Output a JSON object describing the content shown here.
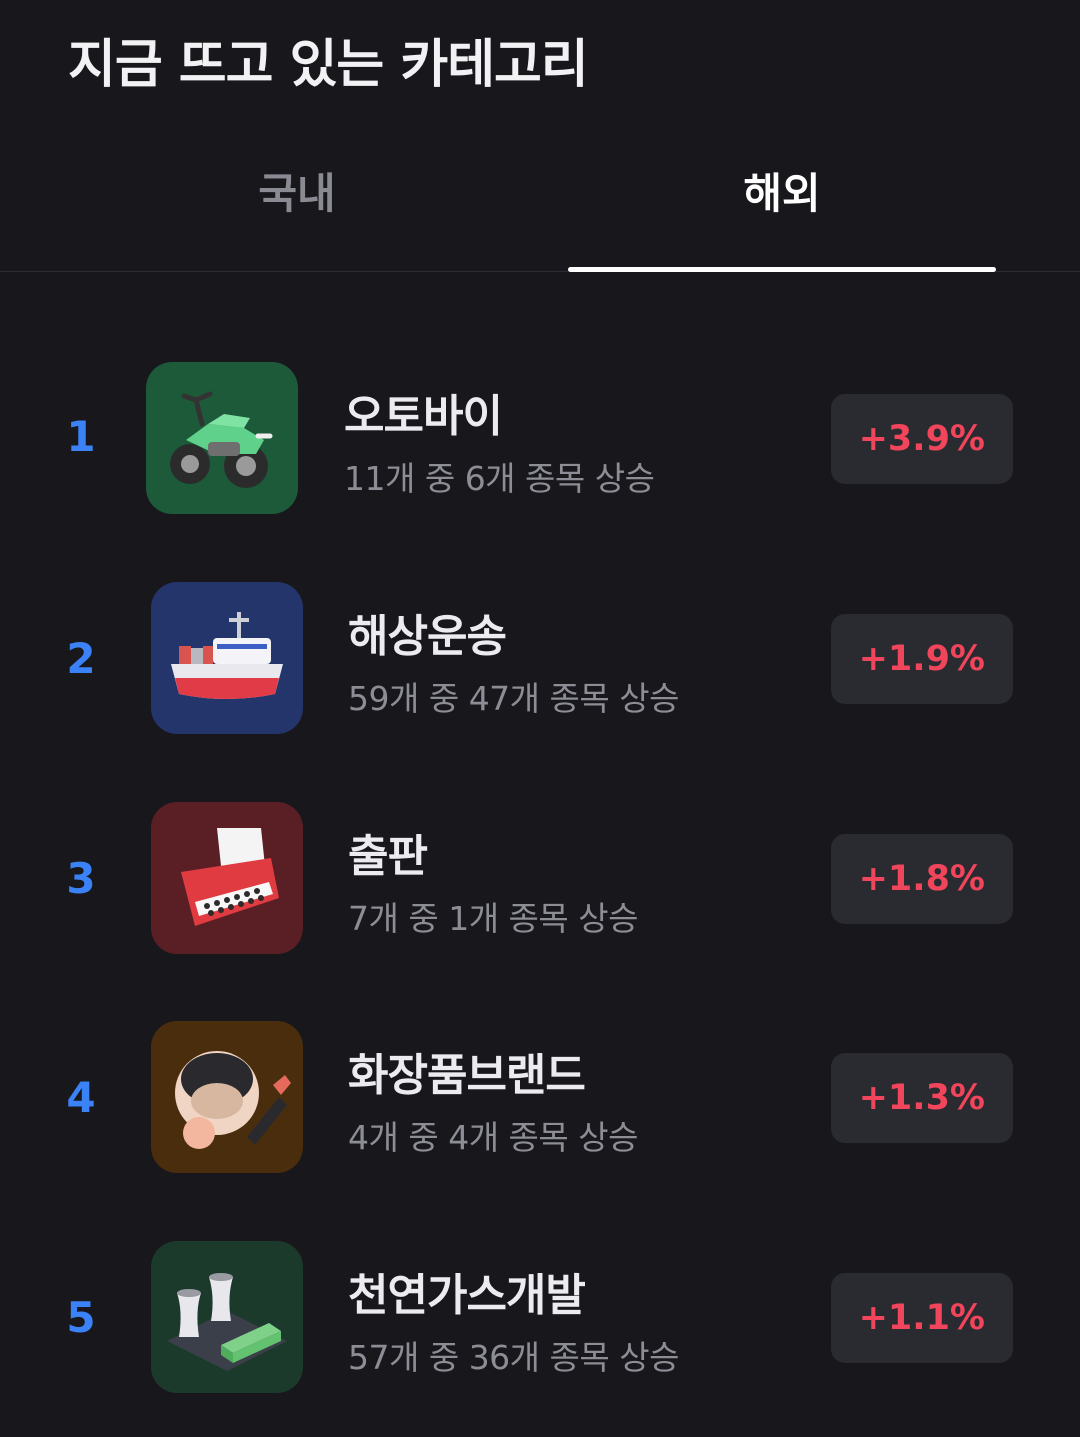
{
  "header": {
    "title": "지금 뜨고 있는 카테고리"
  },
  "tabs": [
    {
      "label": "국내",
      "active": false
    },
    {
      "label": "해외",
      "active": true
    }
  ],
  "colors": {
    "background": "#17171c",
    "rank_blue": "#3b82f6",
    "rise_red": "#f0455a",
    "badge_bg": "#2a2a31"
  },
  "categories": [
    {
      "rank": "1",
      "name": "오토바이",
      "sub": "11개 중 6개 종목 상승",
      "change": "+3.9%",
      "icon": "motorcycle-icon",
      "icon_bg": "#1d5a3a"
    },
    {
      "rank": "2",
      "name": "해상운송",
      "sub": "59개 중 47개 종목 상승",
      "change": "+1.9%",
      "icon": "ship-icon",
      "icon_bg": "#23356a"
    },
    {
      "rank": "3",
      "name": "출판",
      "sub": "7개 중 1개 종목 상승",
      "change": "+1.8%",
      "icon": "typewriter-icon",
      "icon_bg": "#5a1f24"
    },
    {
      "rank": "4",
      "name": "화장품브랜드",
      "sub": "4개 중 4개 종목 상승",
      "change": "+1.3%",
      "icon": "cosmetics-icon",
      "icon_bg": "#4a2d0d"
    },
    {
      "rank": "5",
      "name": "천연가스개발",
      "sub": "57개 중 36개 종목 상승",
      "change": "+1.1%",
      "icon": "gas-plant-icon",
      "icon_bg": "#1c3a2c"
    }
  ]
}
